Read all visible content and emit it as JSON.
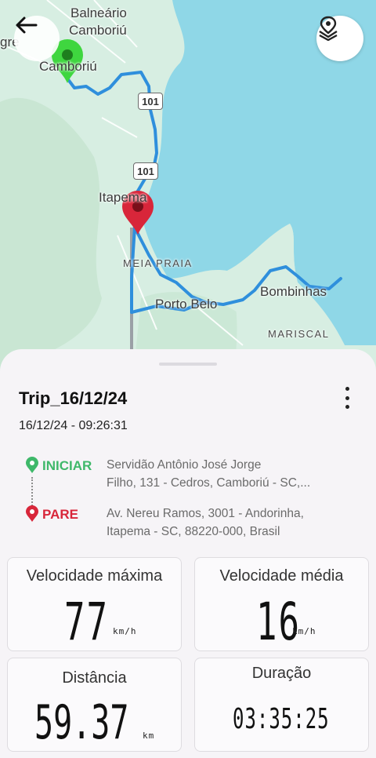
{
  "map": {
    "labels": {
      "balneario": "Balneário",
      "camboriu_top": "Camboriú",
      "camboriu_left": "Camboriú",
      "gre": "gre",
      "itapema": "Itapema",
      "meia_praia": "MEIA PRAIA",
      "porto_belo": "Porto Belo",
      "bombinhas": "Bombinhas",
      "mariscal": "MARISCAL"
    },
    "shields": [
      "101",
      "101"
    ],
    "colors": {
      "water": "#8fd7e7",
      "land": "#d7eee2",
      "route": "#2f8fdc",
      "start_marker": "#3fd63f",
      "end_marker": "#d8263a"
    }
  },
  "toolbar": {
    "back_icon": "arrow-left-icon",
    "layers_icon": "layers-pin-icon"
  },
  "trip": {
    "title": "Trip_16/12/24",
    "datetime": "16/12/24 - 09:26:31",
    "start": {
      "label": "INICIAR",
      "address_line1": "Servidão Antônio José Jorge",
      "address_line2": "Filho, 131 - Cedros, Camboriú - SC,...",
      "color": "#3fb86a"
    },
    "end": {
      "label": "PARE",
      "address_line1": "Av. Nereu Ramos, 3001 - Andorinha,",
      "address_line2": "Itapema - SC, 88220-000, Brasil",
      "color": "#d8263a"
    }
  },
  "stats": {
    "max_speed": {
      "title": "Velocidade máxima",
      "value": "77",
      "unit": "km/h"
    },
    "avg_speed": {
      "title": "Velocidade média",
      "value": "16",
      "unit": "km/h"
    },
    "distance": {
      "title": "Distância",
      "value": "59.37",
      "unit": "km"
    },
    "duration": {
      "title": "Duração",
      "value": "03:35:25"
    }
  }
}
